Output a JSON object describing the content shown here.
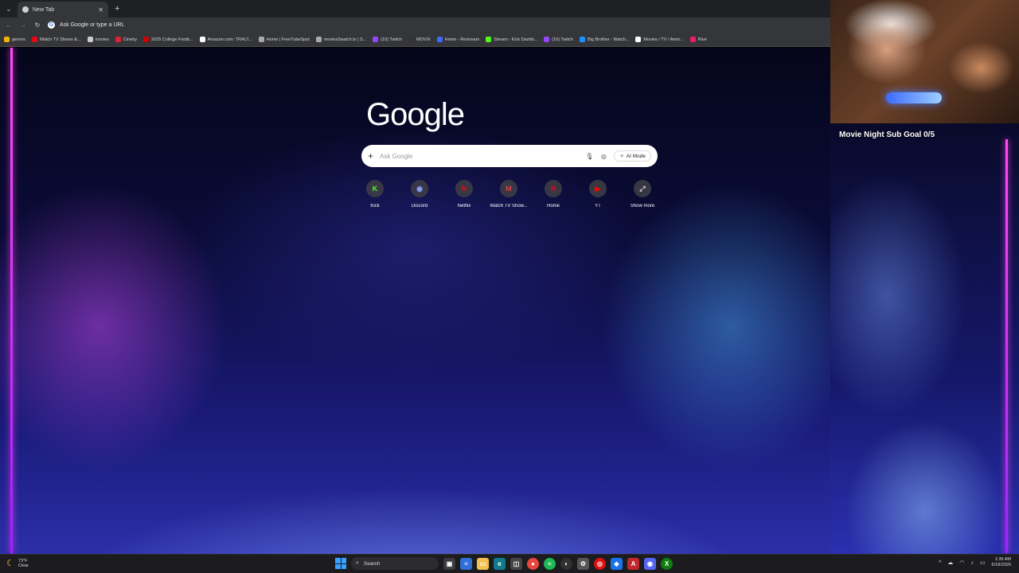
{
  "browser": {
    "tab_title": "New Tab",
    "new_tab_symbol": "+",
    "close_symbol": "✕",
    "omnibox_text": "Ask Google or type a URL"
  },
  "bookmarks": [
    {
      "label": "genres",
      "color": "#f2b400"
    },
    {
      "label": "Watch TV Shows &...",
      "color": "#e50914"
    },
    {
      "label": "movies",
      "color": "#cccccc"
    },
    {
      "label": "Cineby",
      "color": "#d23"
    },
    {
      "label": "2025 College Footb...",
      "color": "#c00"
    },
    {
      "label": "Amazon.com: TRALT...",
      "color": "#ffffff"
    },
    {
      "label": "Home | FreeTubeSpot",
      "color": "#aaaaaa"
    },
    {
      "label": "movies2watch.tv | S...",
      "color": "#aaaaaa"
    },
    {
      "label": "(10) Twitch",
      "color": "#9146ff"
    },
    {
      "label": "MOVIX",
      "color": "#333333"
    },
    {
      "label": "Home - Restream",
      "color": "#3b6cff"
    },
    {
      "label": "Stream - Kick Dashb...",
      "color": "#53fc18"
    },
    {
      "label": "(16) Twitch",
      "color": "#9146ff"
    },
    {
      "label": "Big Brother - Watch...",
      "color": "#1e90ff"
    },
    {
      "label": "Movies / TV / Anim...",
      "color": "#ffffff"
    },
    {
      "label": "Rive",
      "color": "#e91e63"
    }
  ],
  "ntp": {
    "logo": "Google",
    "search_placeholder": "Ask Google",
    "ai_mode_label": "AI Mode",
    "shortcuts": [
      {
        "label": "Kick",
        "glyph": "K",
        "color": "#53fc18"
      },
      {
        "label": "Discord",
        "glyph": "◉",
        "color": "#8ea1ff"
      },
      {
        "label": "Netflix",
        "glyph": "N",
        "color": "#e50914"
      },
      {
        "label": "Watch TV Show...",
        "glyph": "M",
        "color": "#d14545"
      },
      {
        "label": "Home",
        "glyph": "N",
        "color": "#e50914"
      },
      {
        "label": "YT",
        "glyph": "▶",
        "color": "#ff0000"
      },
      {
        "label": "Show more",
        "glyph": "⤢",
        "color": "#dddddd"
      }
    ]
  },
  "overlay": {
    "goal_text": "Movie Night Sub Goal 0/5"
  },
  "taskbar": {
    "weather_temp": "73°F",
    "weather_cond": "Clear",
    "search_label": "Search",
    "time": "1:36 AM",
    "date": "6/18/2026"
  }
}
